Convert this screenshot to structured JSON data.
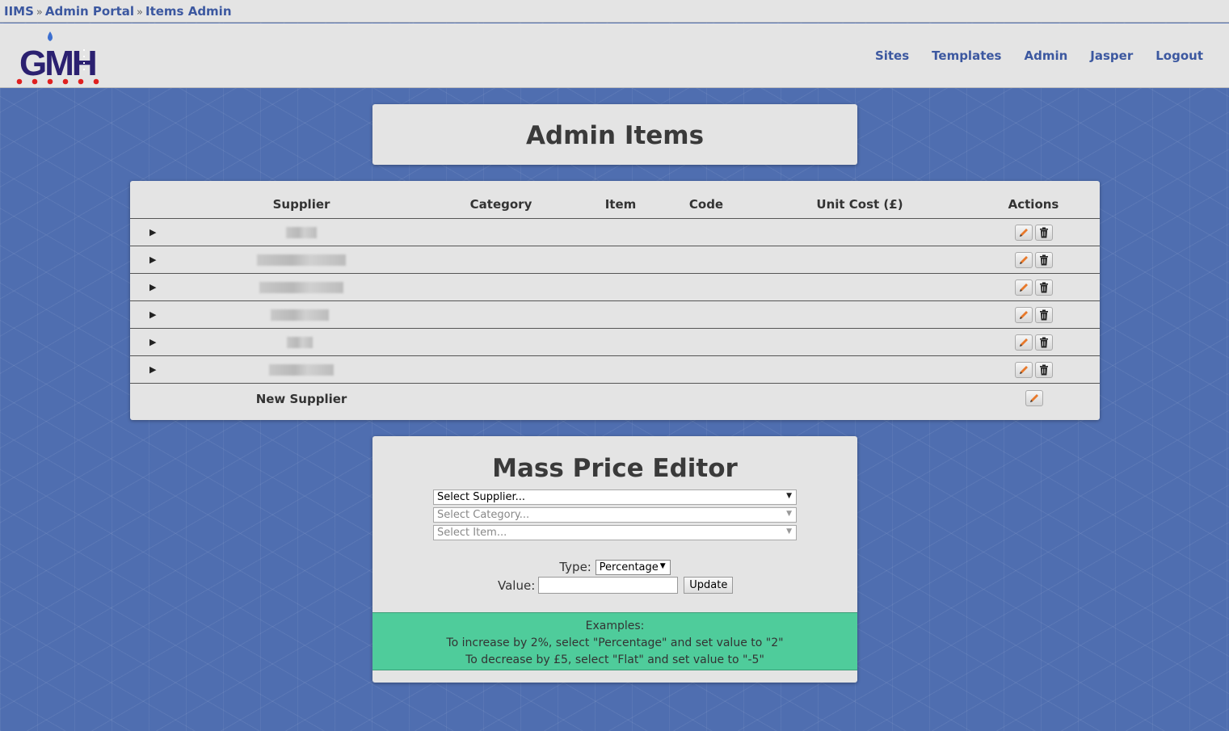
{
  "breadcrumb": {
    "items": [
      "IIMS",
      "Admin Portal",
      "Items Admin"
    ],
    "separator": "»"
  },
  "header": {
    "logo_text": "GMH",
    "nav": [
      "Sites",
      "Templates",
      "Admin",
      "Jasper",
      "Logout"
    ]
  },
  "page_title": "Admin Items",
  "table": {
    "columns": [
      "Supplier",
      "Category",
      "Item",
      "Code",
      "Unit Cost (£)",
      "Actions"
    ],
    "rows": [
      {
        "expand_glyph": "▶",
        "supplier": ""
      },
      {
        "expand_glyph": "▶",
        "supplier": ""
      },
      {
        "expand_glyph": "▶",
        "supplier": ""
      },
      {
        "expand_glyph": "▶",
        "supplier": ""
      },
      {
        "expand_glyph": "▶",
        "supplier": ""
      },
      {
        "expand_glyph": "▶",
        "supplier": ""
      }
    ],
    "new_row_label": "New Supplier",
    "icons": {
      "edit": "pencil-icon",
      "delete": "trash-icon"
    }
  },
  "mass_price_editor": {
    "title": "Mass Price Editor",
    "supplier_select": "Select Supplier...",
    "category_select": "Select Category...",
    "item_select": "Select Item...",
    "type_label": "Type:",
    "type_value": "Percentage",
    "value_label": "Value:",
    "value_input": "",
    "update_label": "Update",
    "examples": {
      "heading": "Examples:",
      "line1": "To increase by 2%, select \"Percentage\" and set value to \"2\"",
      "line2": "To decrease by £5, select \"Flat\" and set value to \"-5\""
    }
  },
  "colors": {
    "background": "#4f6eb0",
    "card": "#e4e4e4",
    "link": "#3c58a0",
    "examples_bg": "#4fcc9b",
    "logo_primary": "#2b2070",
    "logo_dots": "#e02020"
  }
}
